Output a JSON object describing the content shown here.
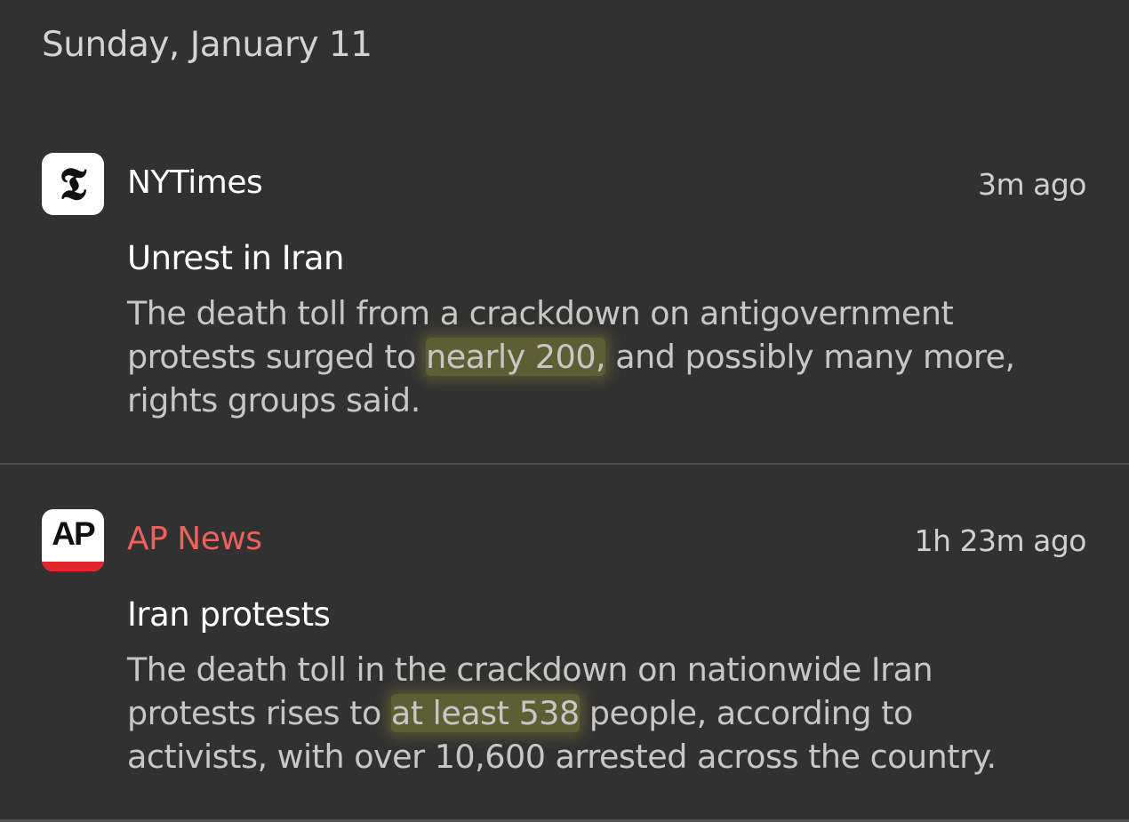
{
  "date_header": "Sunday, January 11",
  "notifications": [
    {
      "app": "NYTimes",
      "app_icon": "nyt-logo-icon",
      "app_icon_glyph": "𝕿",
      "timestamp": "3m ago",
      "title": "Unrest in Iran",
      "body_lines": [
        {
          "pre": "The death toll from a crackdown on antigovernment",
          "hl": "",
          "post": ""
        },
        {
          "pre": "protests surged to ",
          "hl": "nearly 200,",
          "post": " and possibly many more,"
        },
        {
          "pre": "rights groups said.",
          "hl": "",
          "post": ""
        }
      ]
    },
    {
      "app": "AP News",
      "app_icon": "ap-news-logo-icon",
      "app_icon_glyph": "AP",
      "app_color": "#f0615b",
      "timestamp": "1h 23m ago",
      "title": "Iran protests",
      "body_lines": [
        {
          "pre": "The death toll in the crackdown on nationwide Iran",
          "hl": "",
          "post": ""
        },
        {
          "pre": "protests rises to ",
          "hl": "at least 538",
          "post": " people, according to"
        },
        {
          "pre": "activists, with over 10,600 arrested across the country.",
          "hl": "",
          "post": ""
        }
      ]
    }
  ],
  "colors": {
    "background": "#313131",
    "highlight": "#96963c",
    "ap_red": "#e0262a"
  }
}
